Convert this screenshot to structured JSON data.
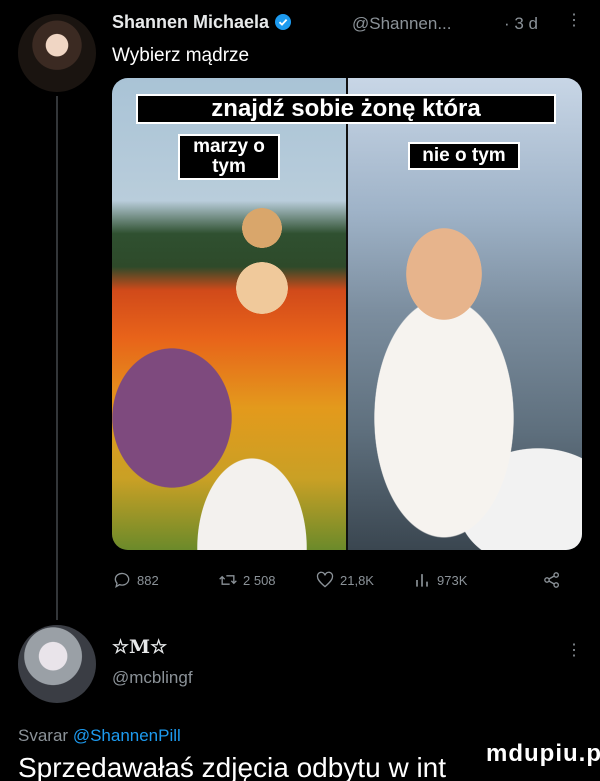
{
  "tweet": {
    "author_name": "Shannen Michaela",
    "handle": "@Shannen...",
    "time": "· 3 d",
    "more": "⋮",
    "text": "Wybierz mądrze",
    "image": {
      "caption_title": "znajdź sobie żonę która",
      "caption_left": "marzy o tym",
      "caption_right": "nie o tym"
    },
    "stats": {
      "replies": "882",
      "retweets": "2 508",
      "likes": "21,8K",
      "views": "973K"
    }
  },
  "reply": {
    "author_name": "☆M☆",
    "handle": "@mcblingf",
    "more": "⋮",
    "replying_prefix": "Svarar",
    "replying_to": "@ShannenPill",
    "text": "Sprzedawałaś zdjęcia odbytu w int"
  },
  "watermark": "mdupiu.pl",
  "colors": {
    "background": "#000000",
    "muted": "#8b9298",
    "link": "#1d9bf0",
    "verified": "#1d9bf0"
  }
}
